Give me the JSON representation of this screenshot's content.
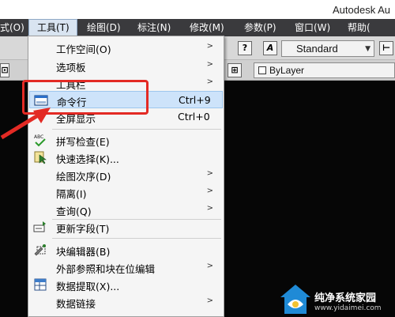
{
  "window": {
    "title": "Autodesk Au"
  },
  "menubar": {
    "items": [
      {
        "label": "式(O)"
      },
      {
        "label": "工具(T)"
      },
      {
        "label": "绘图(D)"
      },
      {
        "label": "标注(N)"
      },
      {
        "label": "修改(M)"
      },
      {
        "label": "参数(P)"
      },
      {
        "label": "窗口(W)"
      },
      {
        "label": "帮助("
      }
    ]
  },
  "toolbar": {
    "text_style": "Standard",
    "layer": "ByLayer",
    "help_icon": "?",
    "text_icon": "A"
  },
  "tools_menu": {
    "items": [
      {
        "label": "工作空间(O)",
        "shortcut": "",
        "submenu": true,
        "icon": ""
      },
      {
        "label": "选项板",
        "shortcut": "",
        "submenu": true,
        "icon": ""
      },
      {
        "label": "工具栏",
        "shortcut": "",
        "submenu": true,
        "icon": ""
      },
      {
        "label": "命令行",
        "shortcut": "Ctrl+9",
        "submenu": false,
        "icon": "command-line-icon",
        "highlighted": true
      },
      {
        "label": "全屏显示",
        "shortcut": "Ctrl+0",
        "submenu": false,
        "icon": ""
      },
      {
        "label": "拼写检查(E)",
        "shortcut": "",
        "submenu": false,
        "icon": "spellcheck-icon"
      },
      {
        "label": "快速选择(K)...",
        "shortcut": "",
        "submenu": false,
        "icon": "quick-select-icon"
      },
      {
        "label": "绘图次序(D)",
        "shortcut": "",
        "submenu": true,
        "icon": ""
      },
      {
        "label": "隔离(I)",
        "shortcut": "",
        "submenu": true,
        "icon": ""
      },
      {
        "label": "查询(Q)",
        "shortcut": "",
        "submenu": true,
        "icon": ""
      },
      {
        "label": "更新字段(T)",
        "shortcut": "",
        "submenu": false,
        "icon": "update-fields-icon"
      },
      {
        "label": "块编辑器(B)",
        "shortcut": "",
        "submenu": false,
        "icon": "block-editor-icon"
      },
      {
        "label": "外部参照和块在位编辑",
        "shortcut": "",
        "submenu": true,
        "icon": ""
      },
      {
        "label": "数据提取(X)...",
        "shortcut": "",
        "submenu": false,
        "icon": "data-extraction-icon"
      },
      {
        "label": "数据链接",
        "shortcut": "",
        "submenu": true,
        "icon": ""
      }
    ]
  },
  "watermark": {
    "text": "纯净系统家园",
    "url": "www.yidaimei.com"
  },
  "colors": {
    "menubar_bg": "#3a3a3d",
    "canvas_bg": "#060606",
    "highlight_bg": "#cde3fa",
    "annotation_red": "#e32a24"
  }
}
